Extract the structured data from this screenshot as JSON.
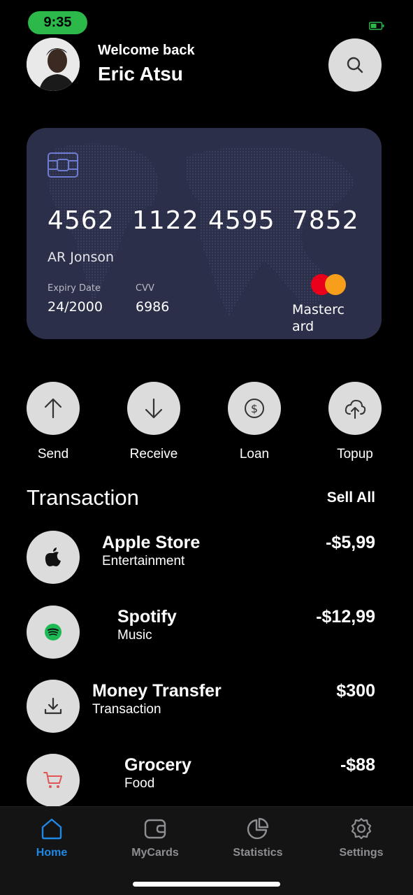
{
  "status_bar": {
    "time": "9:35"
  },
  "header": {
    "welcome": "Welcome back",
    "name": "Eric Atsu"
  },
  "card": {
    "number_groups": [
      "4562",
      "1122",
      "4595",
      "7852"
    ],
    "holder": "AR Jonson",
    "expiry_label": "Expiry Date",
    "expiry_value": "24/2000",
    "cvv_label": "CVV",
    "cvv_value": "6986",
    "brand": "Mastercard",
    "colors": {
      "background": "#2c2f4a",
      "mc_red": "#eb001b",
      "mc_orange": "#f79e1b"
    }
  },
  "actions": [
    {
      "label": "Send",
      "icon": "arrow-up-icon"
    },
    {
      "label": "Receive",
      "icon": "arrow-down-icon"
    },
    {
      "label": "Loan",
      "icon": "dollar-circle-icon"
    },
    {
      "label": "Topup",
      "icon": "cloud-upload-icon"
    }
  ],
  "transactions": {
    "title": "Transaction",
    "see_all": "Sell All",
    "items": [
      {
        "name": "Apple Store",
        "category": "Entertainment",
        "amount": "-$5,99",
        "icon": "apple-icon"
      },
      {
        "name": "Spotify",
        "category": "Music",
        "amount": "-$12,99",
        "icon": "spotify-icon"
      },
      {
        "name": "Money Transfer",
        "category": "Transaction",
        "amount": "$300",
        "icon": "download-icon"
      },
      {
        "name": "Grocery",
        "category": "Food",
        "amount": "-$88",
        "icon": "cart-icon"
      }
    ]
  },
  "nav": {
    "items": [
      {
        "label": "Home",
        "icon": "home-icon",
        "active": true
      },
      {
        "label": "MyCards",
        "icon": "wallet-icon",
        "active": false
      },
      {
        "label": "Statistics",
        "icon": "pie-chart-icon",
        "active": false
      },
      {
        "label": "Settings",
        "icon": "gear-icon",
        "active": false
      }
    ],
    "colors": {
      "active": "#1e88e5",
      "inactive": "#8e8e93"
    }
  },
  "colors": {
    "accent_green": "#2db84a",
    "spotify_green": "#1db954",
    "cart_red": "#e05555"
  }
}
